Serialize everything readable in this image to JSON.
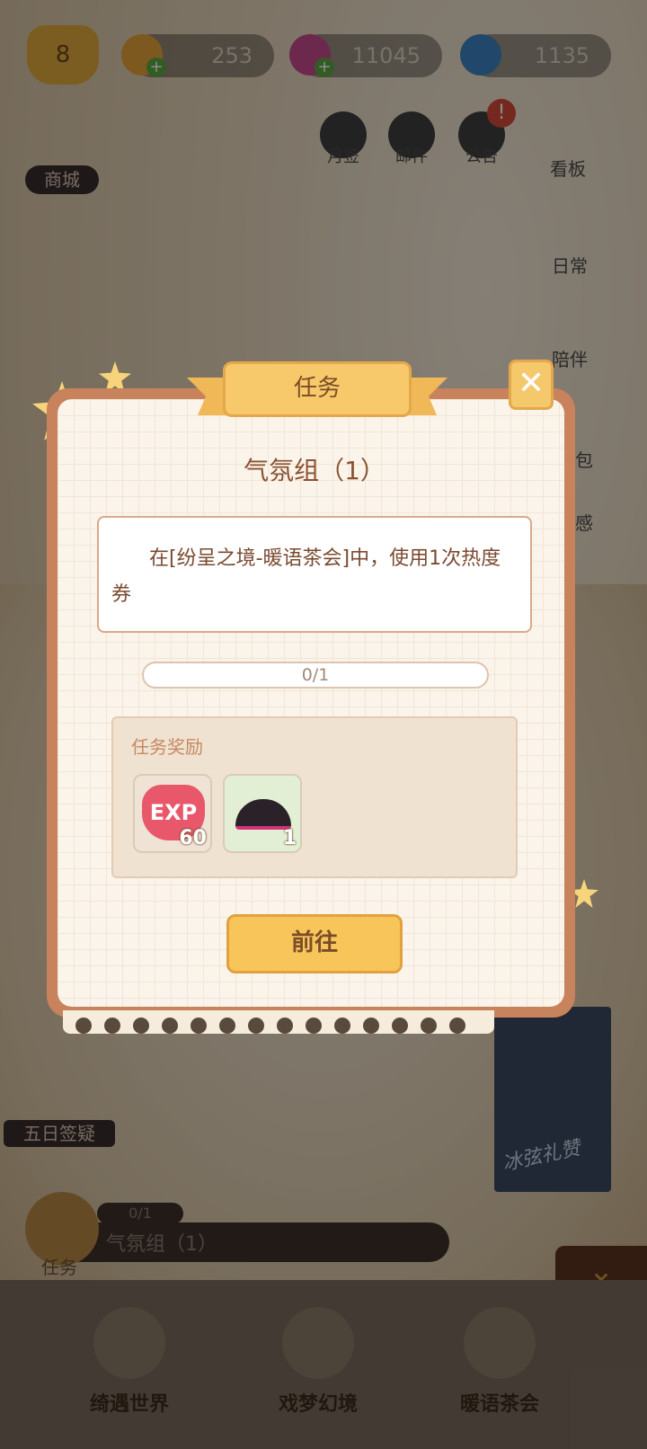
{
  "currency": {
    "level": "8",
    "bells": "253",
    "gems": "11045",
    "crystals": "1135"
  },
  "sidebar_left": {
    "shop": "商城"
  },
  "top_icons": {
    "checkin": "月签",
    "mail": "邮件",
    "notice": "公告"
  },
  "sidebar_right": {
    "board": "看板",
    "daily": "日常",
    "companion": "陪伴",
    "pack": "包",
    "feel": "感"
  },
  "dialog": {
    "header": "任务",
    "title": "气氛组（1）",
    "description": "在[纷呈之境-暖语茶会]中，使用1次热度券",
    "progress": "0/1",
    "reward_title": "任务奖励",
    "rewards": [
      {
        "label": "EXP",
        "qty": "60"
      },
      {
        "label": "hat",
        "qty": "1"
      }
    ],
    "go_button": "前往"
  },
  "event": {
    "label": "五日签疑"
  },
  "poster": {
    "text": "冰弦礼赞"
  },
  "task_bar": {
    "label": "任务",
    "progress": "0/1",
    "current": "气氛组（1）"
  },
  "nav": [
    {
      "label": "绮遇世界"
    },
    {
      "label": "戏梦幻境"
    },
    {
      "label": "暖语茶会"
    }
  ],
  "colors": {
    "accent": "#f7c55a",
    "frame": "#c8825c",
    "text_brown": "#8a5232"
  }
}
